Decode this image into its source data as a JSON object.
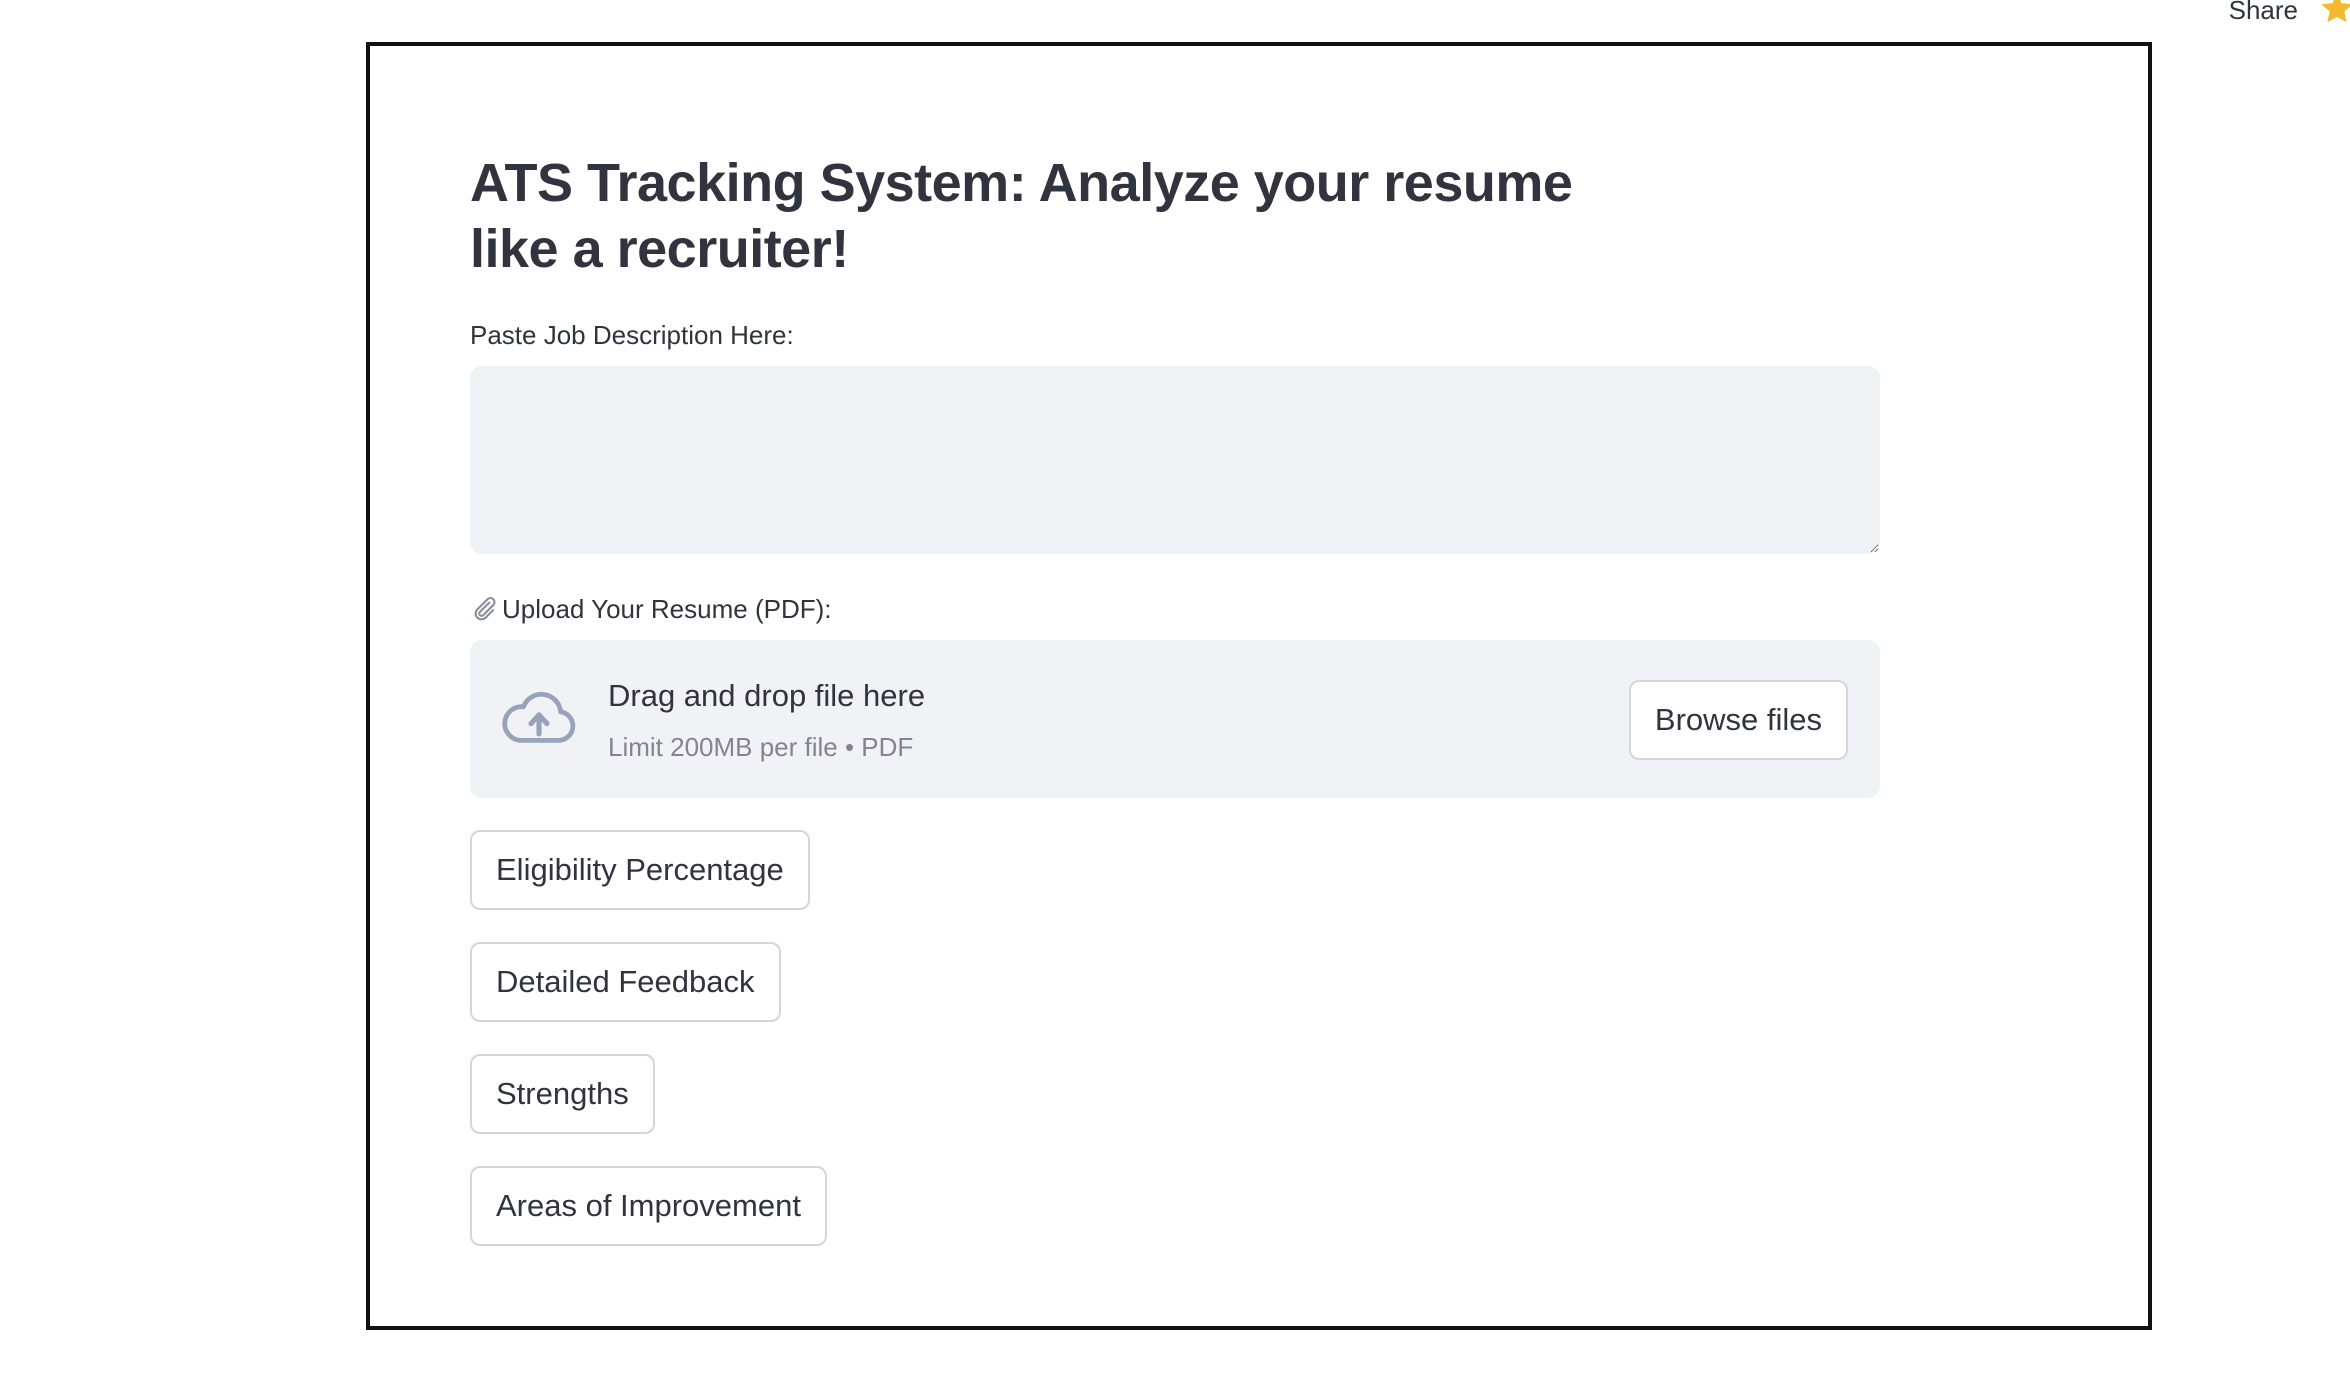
{
  "header": {
    "share_label": "Share",
    "star_icon": "star-icon",
    "star_color": "#f5b82e"
  },
  "app": {
    "title": "ATS Tracking System: Analyze your resume like a recruiter!"
  },
  "job_description": {
    "label": "Paste Job Description Here:",
    "value": ""
  },
  "resume_upload": {
    "icon": "paperclip-icon",
    "label": "Upload Your Resume (PDF):",
    "dropzone_primary": "Drag and drop file here",
    "dropzone_secondary": "Limit 200MB per file • PDF",
    "browse_label": "Browse files",
    "cloud_icon": "cloud-upload-icon"
  },
  "actions": {
    "eligibility": "Eligibility Percentage",
    "feedback": "Detailed Feedback",
    "strengths": "Strengths",
    "improvement": "Areas of Improvement"
  },
  "colors": {
    "text": "#31333f",
    "muted": "#808495",
    "input_bg": "#f0f2f6",
    "button_border": "#d6d6d9",
    "frame_border": "#111111"
  }
}
